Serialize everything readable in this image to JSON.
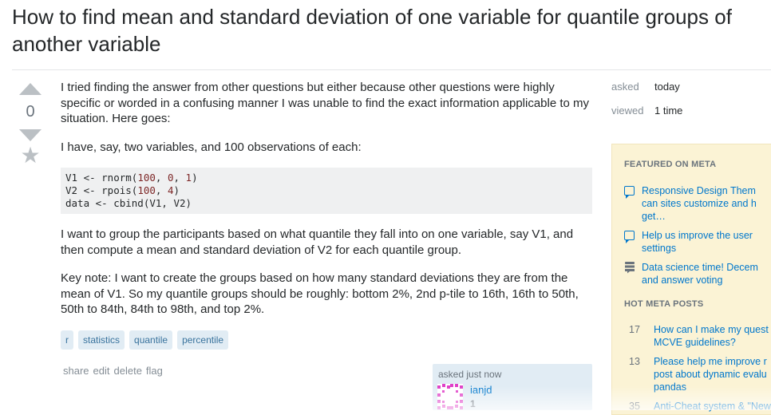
{
  "question": {
    "title": "How to find mean and standard deviation of one variable for quantile groups of another variable",
    "votes": "0",
    "paragraphs": [
      "I tried finding the answer from other questions but either because other questions were highly specific or worded in a confusing manner I was unable to find the exact information applicable to my situation. Here goes:",
      "I have, say, two variables, and 100 observations of each:",
      "I want to group the participants based on what quantile they fall into on one variable, say V1, and then compute a mean and standard deviation of V2 for each quantile group.",
      "Key note: I want to create the groups based on how many standard deviations they are from the mean of V1. So my quantile groups should be roughly: bottom 2%, 2nd p-tile to 16th, 16th to 50th, 50th to 84th, 84th to 98th, and top 2%."
    ],
    "code": {
      "line1_a": "V1 <- rnorm(",
      "line1_n1": "100",
      "line1_b": ", ",
      "line1_n2": "0",
      "line1_c": ", ",
      "line1_n3": "1",
      "line1_d": ")",
      "line2_a": "V2 <- rpois(",
      "line2_n1": "100",
      "line2_b": ", ",
      "line2_n2": "4",
      "line2_c": ")",
      "line3": "data <- cbind(V1, V2)"
    },
    "tags": [
      "r",
      "statistics",
      "quantile",
      "percentile"
    ],
    "menu": [
      "share",
      "edit",
      "delete",
      "flag"
    ],
    "signature": {
      "action": "asked just now",
      "user": "ianjd",
      "reputation": "1"
    }
  },
  "meta": {
    "asked_label": "asked",
    "asked_value": "today",
    "viewed_label": "viewed",
    "viewed_value": "1 time"
  },
  "bulletin": {
    "featured_heading": "FEATURED ON META",
    "featured": [
      {
        "icon": "meta-bubble-icon",
        "text": "Responsive Design Them\ncan sites customize and h\nget…"
      },
      {
        "icon": "meta-bubble-icon",
        "text": "Help us improve the user\nsettings"
      },
      {
        "icon": "stack-exchange-icon",
        "text": "Data science time! Decem\nand answer voting"
      }
    ],
    "hot_heading": "HOT META POSTS",
    "hot": [
      {
        "count": "17",
        "text": "How can I make my quest\nMCVE guidelines?"
      },
      {
        "count": "13",
        "text": "Please help me improve r\npost about dynamic evalu\npandas"
      },
      {
        "count": "35",
        "text": "Anti-Cheat system & \"New"
      }
    ]
  },
  "colors": {
    "link": "#0077cc",
    "tag_bg": "#e1ecf4",
    "tag_text": "#39739d",
    "bulletin_bg": "#fbf3d5",
    "signature_bg": "#e1ecf4"
  }
}
